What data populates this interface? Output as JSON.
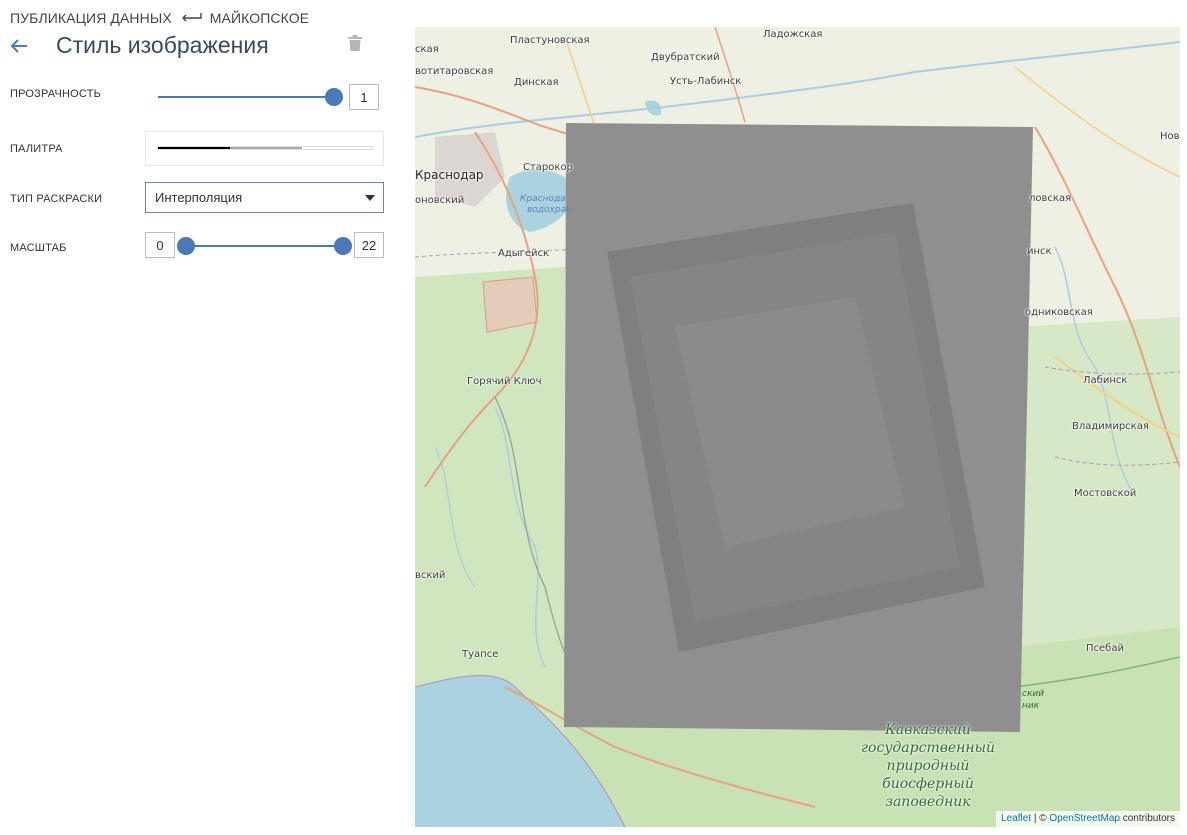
{
  "breadcrumb": {
    "parent": "ПУБЛИКАЦИЯ ДАННЫХ",
    "current": "МАЙКОПСКОЕ",
    "separator_icon": "return-arrow-icon"
  },
  "header": {
    "title": "Стиль изображения",
    "back_icon": "arrow-left-icon",
    "delete_icon": "trash-icon"
  },
  "controls": {
    "opacity": {
      "label": "ПРОЗРАЧНОСТЬ",
      "value": "1"
    },
    "palette": {
      "label": "ПАЛИТРА",
      "colors": [
        "#000000",
        "#a9a9a9",
        "#ffffff"
      ]
    },
    "coloring": {
      "label": "ТИП РАСКРАСКИ",
      "selected": "Интерполяция"
    },
    "scale": {
      "label": "МАСШТАБ",
      "min": "0",
      "max": "22"
    }
  },
  "colors": {
    "accent": "#4a78b8",
    "title": "#3a4a5c"
  },
  "map": {
    "labels": {
      "l1": "Пластуновская",
      "l2": "Ладожская",
      "l3": "Двубратский",
      "l4": "Динская",
      "l5": "Усть-Лабинск",
      "l6": "вотитаровская",
      "l7": "Старокор",
      "l8": "Краснодар",
      "l9": "оновский",
      "l10": "Адыгейск",
      "l11": "Горячий Ключ",
      "l12": "ловская",
      "l13": "инск",
      "l14": "одниковская",
      "l15": "Лабинск",
      "l16": "Владимирская",
      "l17": "Мостовской",
      "l18": "Туапсе",
      "l19": "Псебай",
      "l20": "вский",
      "l21": "ская",
      "l22": "Нов",
      "water1": "Краснода",
      "water2": "водохран",
      "reserve1": "Кавказский",
      "reserve2": "государственный",
      "reserve3": "природный",
      "reserve4": "биосферный",
      "reserve5": "заповедник",
      "reserve_side1": "ский",
      "reserve_side2": "ник"
    },
    "attribution": {
      "leaflet": "Leaflet",
      "separator": " | © ",
      "osm": "OpenStreetMap",
      "suffix": " contributors"
    }
  }
}
